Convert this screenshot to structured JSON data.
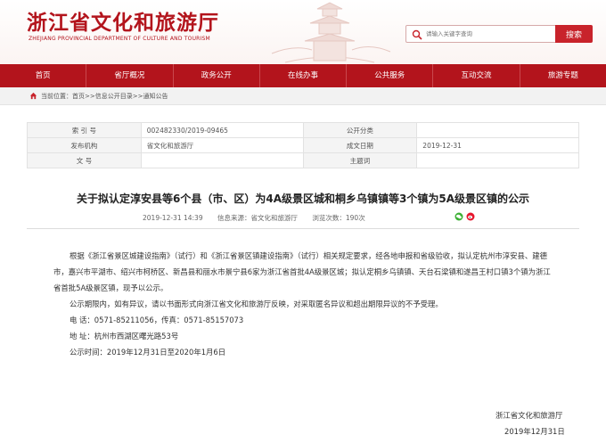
{
  "header": {
    "title": "浙江省文化和旅游厅",
    "subtitle": "ZHEJIANG PROVINCIAL DEPARTMENT OF CULTURE AND TOURISM",
    "search_placeholder": "请输入关键字查询",
    "search_button": "搜索",
    "brand_color": "#b3141c"
  },
  "nav": {
    "items": [
      "首页",
      "省厅概况",
      "政务公开",
      "在线办事",
      "公共服务",
      "互动交流",
      "旅游专题"
    ]
  },
  "breadcrumb": {
    "text": "当前位置：首页>>信息公开目录>>通知公告"
  },
  "info": {
    "rows": [
      {
        "label1": "索 引 号",
        "value1": "002482330/2019-09465",
        "label2": "公开分类",
        "value2": ""
      },
      {
        "label1": "发布机构",
        "value1": "省文化和旅游厅",
        "label2": "成文日期",
        "value2": "2019-12-31"
      },
      {
        "label1": "文 号",
        "value1": "",
        "label2": "主题词",
        "value2": ""
      }
    ]
  },
  "article": {
    "title": "关于拟认定淳安县等6个县（市、区）为4A级景区城和桐乡乌镇镇等3个镇为5A级景区镇的公示",
    "date": "2019-12-31 14:39",
    "source": "信息来源：省文化和旅游厅",
    "views": "浏览次数：190次",
    "paragraph1": "根据《浙江省景区城建设指南》（试行）和《浙江省景区镇建设指南》（试行）相关规定要求，经各地申报和省级验收，拟认定杭州市淳安县、建德市，嘉兴市平湖市、绍兴市柯桥区、新昌县和丽水市景宁县6家为浙江省首批4A级景区城；拟认定桐乡乌镇镇、天台石梁镇和遂昌王村口镇3个镇为浙江省首批5A级景区镇，现予以公示。",
    "paragraph2": "公示期限内，如有异议，请以书面形式向浙江省文化和旅游厅反映，对采取匿名异议和超出期限异议的不予受理。",
    "phone": "电  话：0571-85211056，传真：0571-85157073",
    "address": "地  址：杭州市西湖区曙光路53号",
    "period": "公示时间：2019年12月31日至2020年1月6日",
    "sign_org": "浙江省文化和旅游厅",
    "sign_date": "2019年12月31日"
  }
}
